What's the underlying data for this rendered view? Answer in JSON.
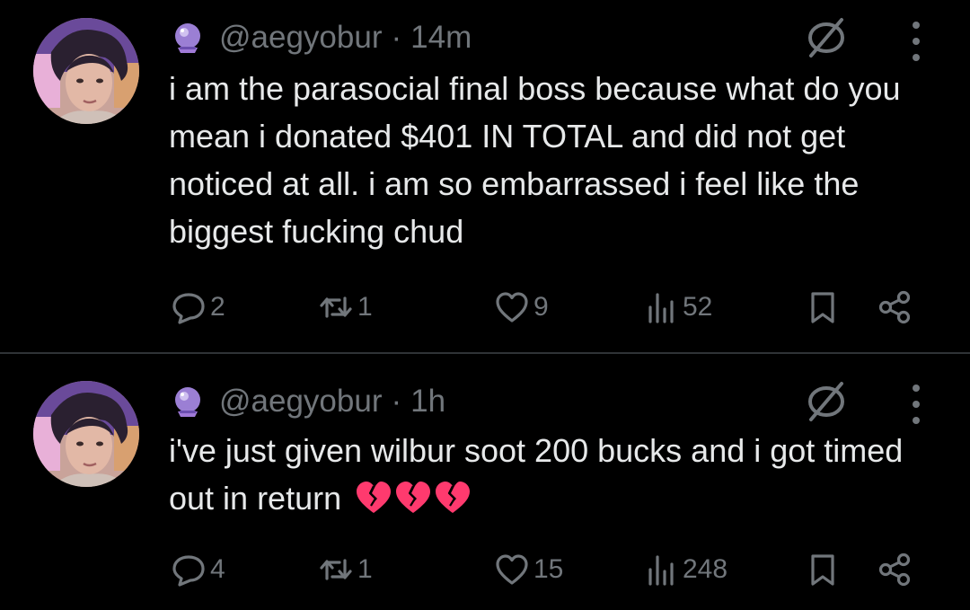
{
  "tweets": [
    {
      "handle": "@aegyobur",
      "separator": "·",
      "time": "14m",
      "text": "i am the parasocial final boss because what do you mean i donated $401 IN TOTAL and did not get noticed at all. i am so embarrassed i feel like the biggest fucking chud",
      "emoji": "",
      "replies": "2",
      "retweets": "1",
      "likes": "9",
      "views": "52"
    },
    {
      "handle": "@aegyobur",
      "separator": "·",
      "time": "1h",
      "text": "i've just given wilbur soot 200 bucks and i got timed out in return",
      "emoji": "💔💔💔",
      "replies": "4",
      "retweets": "1",
      "likes": "15",
      "views": "248"
    }
  ],
  "icons": {
    "badge": "crystal-ball-icon",
    "mute": "mute-conversation-icon",
    "more": "more-vertical-icon",
    "reply": "reply-icon",
    "retweet": "retweet-icon",
    "like": "heart-icon",
    "views": "views-icon",
    "bookmark": "bookmark-icon",
    "share": "share-icon",
    "broken_heart": "broken-heart-icon"
  },
  "colors": {
    "background": "#000000",
    "text": "#e7e9ea",
    "secondary": "#71767b",
    "divider": "#2f3336",
    "broken_heart": "#ff3a6e"
  }
}
